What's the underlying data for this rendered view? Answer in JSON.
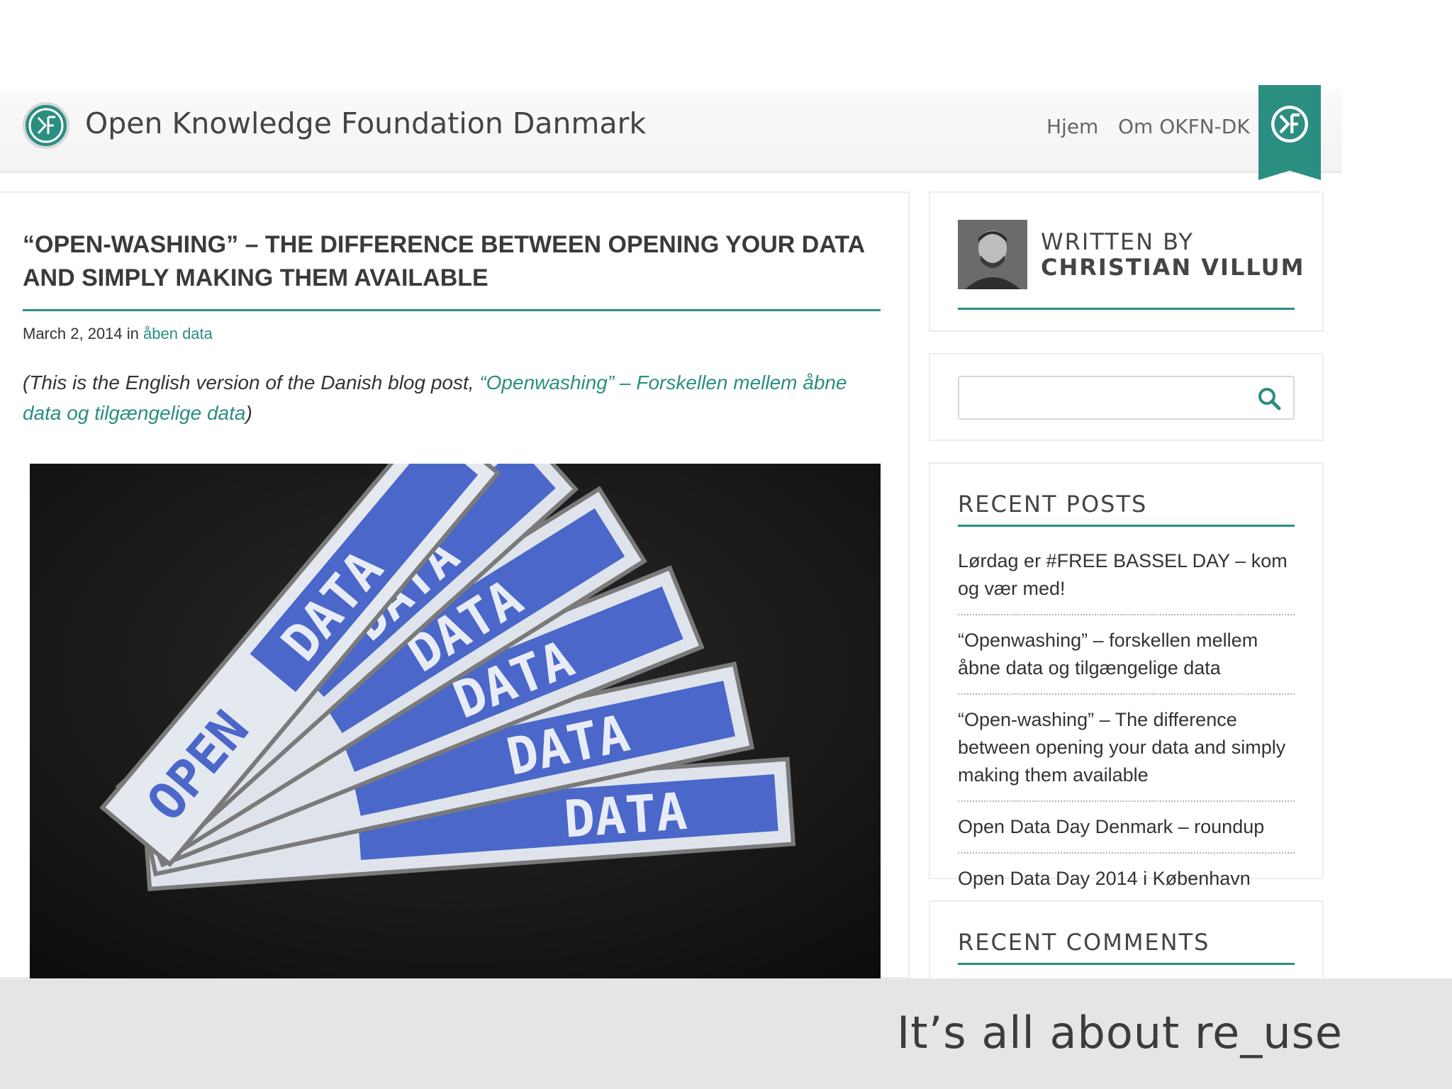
{
  "site": {
    "title": "Open Knowledge Foundation Danmark",
    "nav": [
      "Hjem",
      "Om OKFN-DK"
    ],
    "accent_color": "#2a8e80"
  },
  "post": {
    "title": "“OPEN-WASHING” – THE DIFFERENCE BETWEEN OPENING YOUR DATA AND SIMPLY MAKING THEM AVAILABLE",
    "date": "March 2, 2014",
    "in_word": "in",
    "category": "åben data",
    "intro_before": "(This is the English version of the Danish blog post, ",
    "intro_link": "“Openwashing” – Forskellen mellem åbne data og tilgængelige data",
    "intro_after": ")",
    "photo_labels": [
      "OPEN",
      "DATA",
      "DATA",
      "DATA",
      "DATA",
      "DATA"
    ]
  },
  "sidebar": {
    "written_by": "WRITTEN BY",
    "author": "CHRISTIAN VILLUM",
    "search_value": "",
    "recent_posts_title": "RECENT POSTS",
    "recent_posts": [
      "Lørdag er #FREE BASSEL DAY – kom og vær med!",
      "“Openwashing” – forskellen mellem åbne data og tilgængelige data",
      "“Open-washing” – The difference between opening your data and simply making them available",
      "Open Data Day Denmark – roundup",
      "Open Data Day 2014 i København"
    ],
    "recent_comments_title": "RECENT COMMENTS"
  },
  "caption": "It’s all about re_use",
  "icons": {
    "logo": "okfn-logo-icon",
    "ribbon": "okfn-ribbon-icon",
    "search": "search-icon"
  }
}
